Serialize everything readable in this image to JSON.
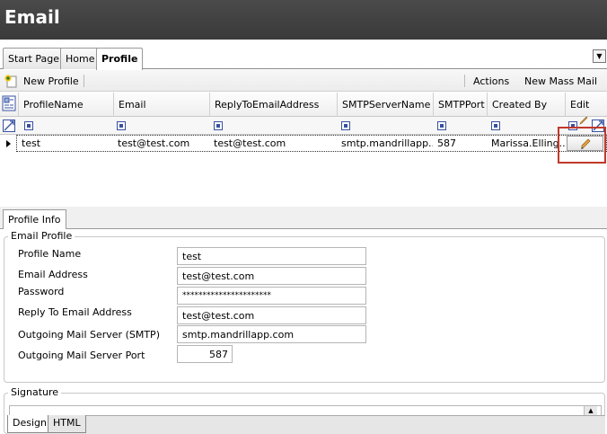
{
  "window": {
    "title": "Email"
  },
  "tabs": [
    {
      "label": "Start Page",
      "active": false
    },
    {
      "label": "Home",
      "active": false
    },
    {
      "label": "Profile",
      "active": true
    }
  ],
  "toolbar": {
    "new_profile": "New Profile",
    "actions": "Actions",
    "new_mass_mail": "New Mass Mail"
  },
  "grid": {
    "columns": [
      "ProfileName",
      "Email",
      "ReplyToEmailAddress",
      "SMTPServerName",
      "SMTPPort",
      "Created By",
      "Edit"
    ],
    "rows": [
      {
        "profile_name": "test",
        "email": "test@test.com",
        "reply_to": "test@test.com",
        "smtp_server": "smtp.mandrillapp....",
        "smtp_port": "587",
        "created_by": "Marissa.Elling..."
      }
    ]
  },
  "profile_info": {
    "tab": "Profile Info",
    "group": "Email Profile",
    "fields": {
      "profile_name": {
        "label": "Profile Name",
        "value": "test"
      },
      "email_address": {
        "label": "Email Address",
        "value": "test@test.com"
      },
      "password": {
        "label": "Password",
        "value": "**********************"
      },
      "reply_to": {
        "label": "Reply To Email Address",
        "value": "test@test.com"
      },
      "smtp_server": {
        "label": "Outgoing Mail Server (SMTP)",
        "value": "smtp.mandrillapp.com"
      },
      "smtp_port": {
        "label": "Outgoing Mail Server Port",
        "value": "587"
      }
    }
  },
  "signature": {
    "label": "Signature",
    "tabs": [
      "Design",
      "HTML"
    ]
  },
  "colors": {
    "titlebar": "#3f3f3f",
    "highlight": "#c0392b",
    "filter_icon": "#3850a0"
  },
  "icons": [
    "new-profile-icon",
    "column-chooser-icon",
    "filter-clear-icon",
    "row-indicator-icon",
    "edit-pencil-icon",
    "dropdown-icon"
  ]
}
